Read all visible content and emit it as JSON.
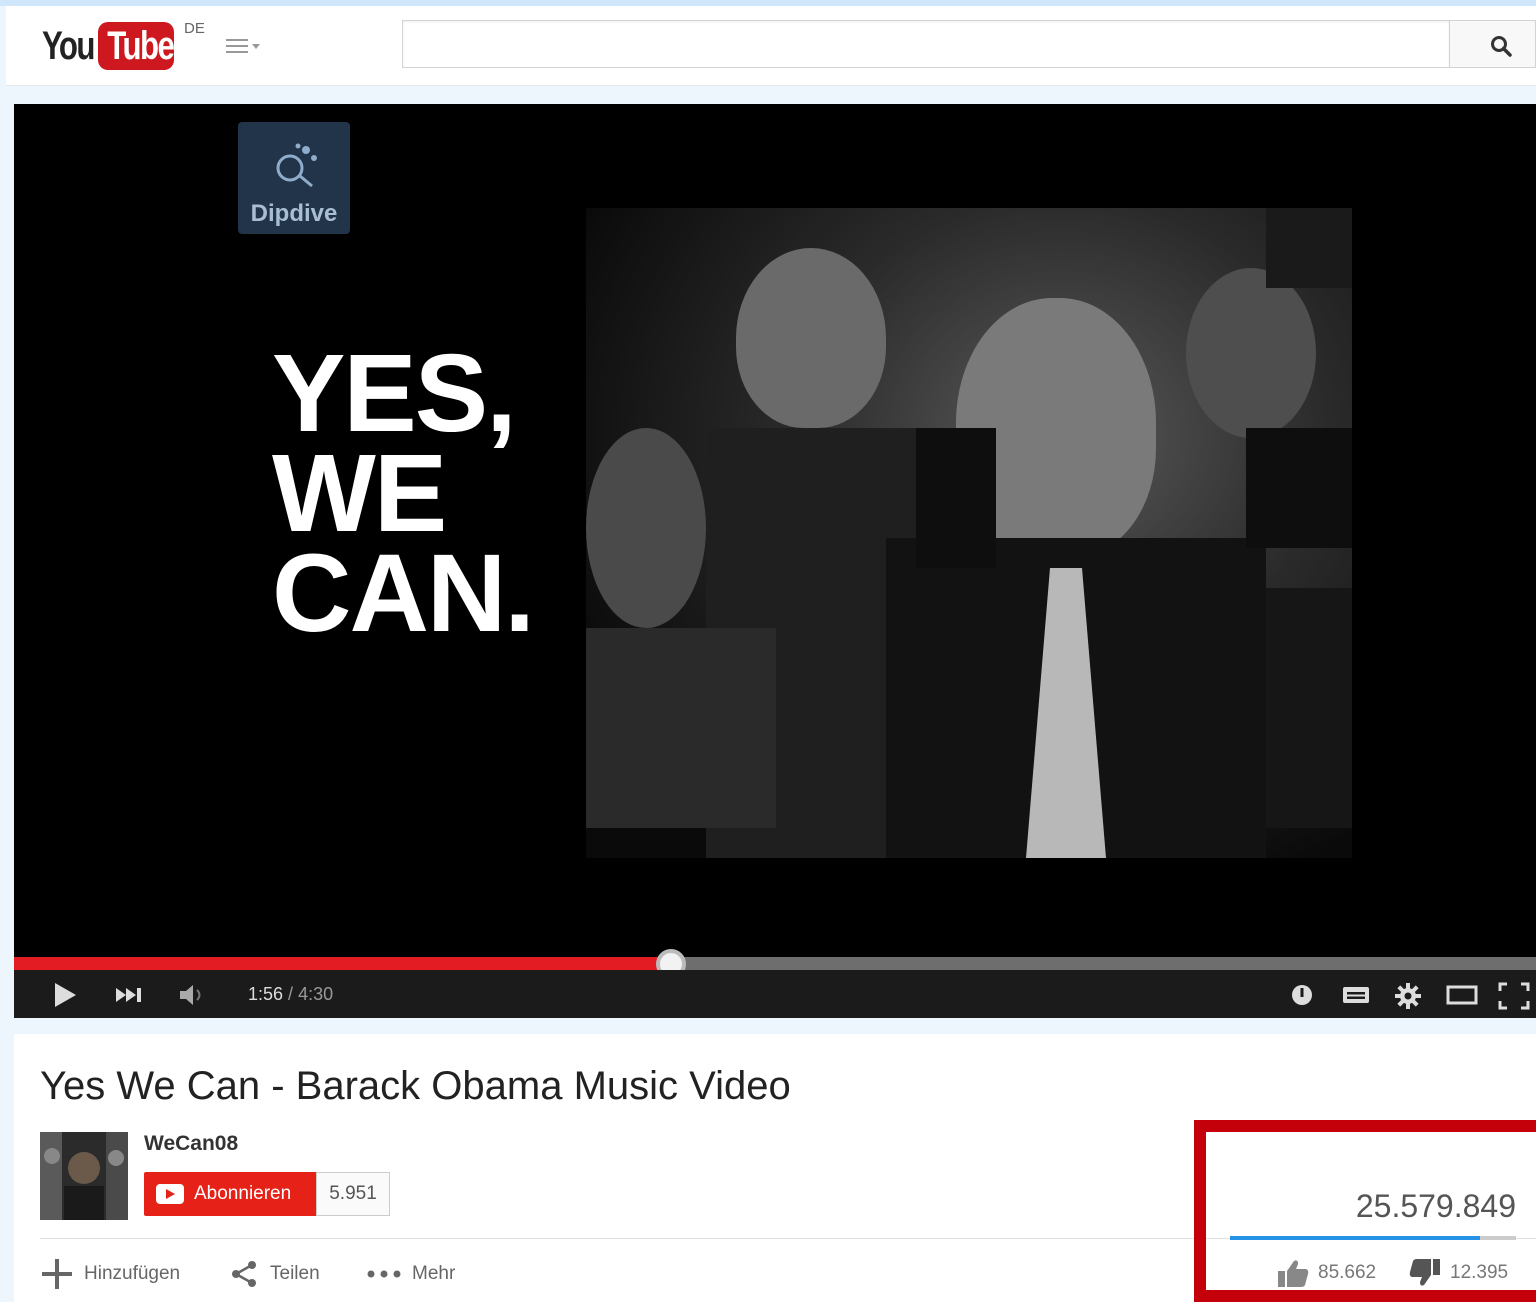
{
  "masthead": {
    "logo_you": "You",
    "logo_tube": "Tube",
    "region": "DE",
    "search_value": ""
  },
  "player": {
    "watermark_text": "Dipdive",
    "slogan_lines": [
      "YES,",
      "WE",
      "CAN."
    ],
    "current_time": "1:56",
    "separator": " / ",
    "total_time": "4:30",
    "progress": 0.4318
  },
  "video": {
    "title": "Yes We Can - Barack Obama Music Video",
    "channel": "WeCan08",
    "subscribe_label": "Abonnieren",
    "subscriber_count": "5.951",
    "views": "25.579.849",
    "likes": "85.662",
    "dislikes": "12.395",
    "like_ratio": 0.8735
  },
  "actions": {
    "add_label": "Hinzufügen",
    "share_label": "Teilen",
    "more_label": "Mehr"
  },
  "colors": {
    "brand_red": "#cc181e",
    "progress_red": "#e31b23",
    "like_blue": "#2793e6",
    "highlight": "#c4000b"
  }
}
